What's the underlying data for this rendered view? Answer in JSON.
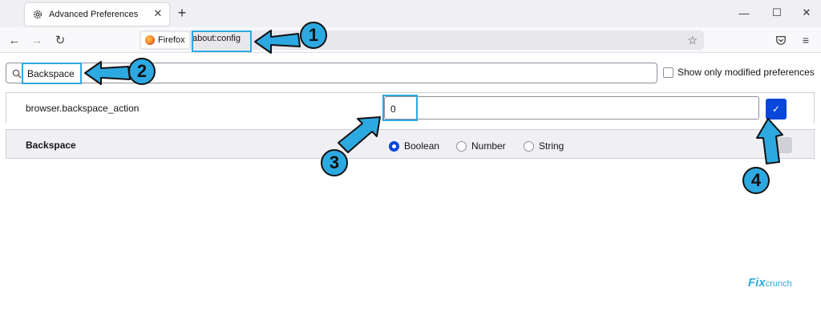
{
  "tab": {
    "title": "Advanced Preferences",
    "icon": "gear-icon",
    "close_icon": "close-icon"
  },
  "toolbar": {
    "new_tab_glyph": "+",
    "identity_label": "Firefox",
    "url": "about:config"
  },
  "search": {
    "value": "Backspace",
    "icon": "search-icon"
  },
  "modified_only": {
    "label": "Show only modified preferences",
    "checked": false
  },
  "pref": {
    "name": "browser.backspace_action",
    "value": "0"
  },
  "new_pref": {
    "name": "Backspace",
    "types": [
      {
        "label": "Boolean",
        "selected": true
      },
      {
        "label": "Number",
        "selected": false
      },
      {
        "label": "String",
        "selected": false
      }
    ]
  },
  "callouts": [
    "1",
    "2",
    "3",
    "4"
  ],
  "colors": {
    "accent": "#2da9e1",
    "primary_button": "#0a46d9"
  },
  "watermark": {
    "part1": "Fix",
    "part2": "crunch"
  }
}
